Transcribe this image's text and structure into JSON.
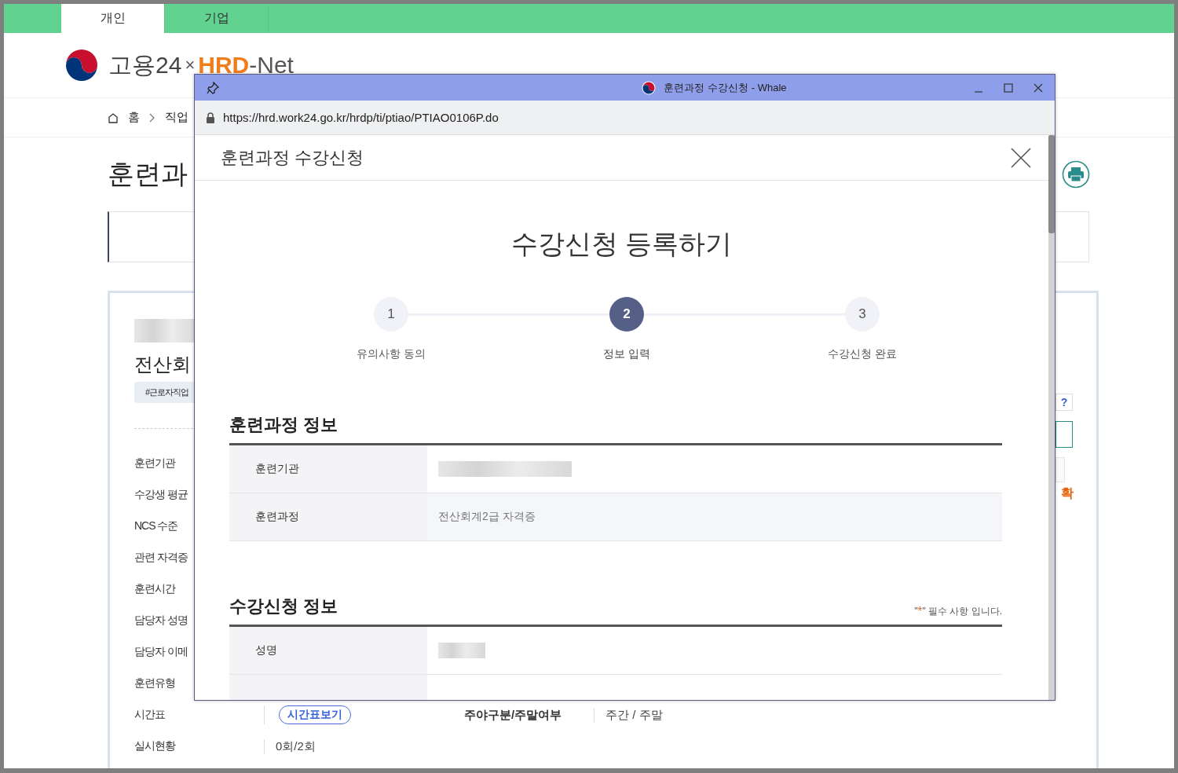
{
  "site_tabs": [
    {
      "label": "개인",
      "selected": true
    },
    {
      "label": "기업",
      "selected": false
    }
  ],
  "logo": {
    "brand": "고용24",
    "separator": "×",
    "accent": "HRD",
    "rest": "-Net"
  },
  "breadcrumb": [
    "홈",
    "직업"
  ],
  "page_title": "훈련과",
  "course": {
    "title": "전산회",
    "tag": "#근로자직업"
  },
  "info_rows": [
    {
      "label": "훈련기관"
    },
    {
      "label": "수강생 평균"
    },
    {
      "label": "NCS 수준"
    },
    {
      "label": "관련 자격증"
    },
    {
      "label": "훈련시간"
    },
    {
      "label": "담당자 성명"
    },
    {
      "label": "담당자 이메"
    },
    {
      "label": "훈련유형"
    },
    {
      "label": "시간표",
      "button": "시간표보기",
      "label_2": "주야구분/주말여부",
      "value_2": "주간 / 주말"
    },
    {
      "label": "실시현황",
      "value": "0회/2회"
    }
  ],
  "side_marks": {
    "help": "?",
    "confirm": "확"
  },
  "popup": {
    "title": "훈련과정 수강신청 - Whale",
    "url": "https://hrd.work24.go.kr/hrdp/ti/ptiao/PTIAO0106P.do",
    "header": "훈련과정 수강신청",
    "heading": "수강신청 등록하기",
    "steps": [
      {
        "number": "1",
        "label": "유의사항 동의",
        "selected": false
      },
      {
        "number": "2",
        "label": "정보 입력",
        "selected": true
      },
      {
        "number": "3",
        "label": "수강신청 완료",
        "selected": false
      }
    ],
    "sections": [
      {
        "title": "훈련과정 정보",
        "rows": [
          {
            "label": "훈련기관",
            "kind": "redacted"
          },
          {
            "label": "훈련과정",
            "kind": "readonly",
            "value": "전산회계2급 자격증"
          }
        ]
      },
      {
        "title": "수강신청 정보",
        "note": {
          "before": "\"",
          "mark": "*",
          "after": "\" 필수 사항 입니다."
        },
        "rows": [
          {
            "label": "성명",
            "kind": "redacted"
          },
          {
            "kind": "cut"
          }
        ]
      }
    ]
  }
}
